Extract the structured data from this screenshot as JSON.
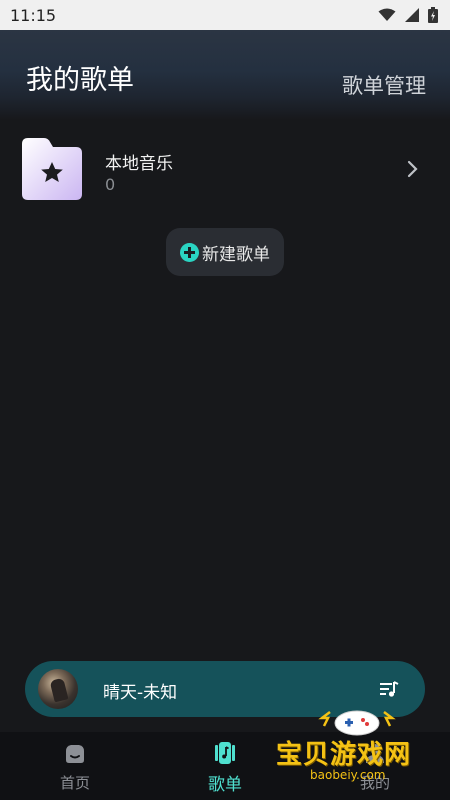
{
  "status_bar": {
    "time": "11:15"
  },
  "header": {
    "title": "我的歌单",
    "manage_label": "歌单管理"
  },
  "local_music": {
    "title": "本地音乐",
    "count": "0"
  },
  "new_playlist": {
    "label": "新建歌单"
  },
  "player": {
    "now_playing": "晴天-未知"
  },
  "bottom_nav": {
    "items": [
      {
        "label": "首页",
        "icon": "home-icon",
        "active": false
      },
      {
        "label": "歌单",
        "icon": "playlist-icon",
        "active": true
      },
      {
        "label": "我的",
        "icon": "profile-icon",
        "active": false
      }
    ]
  },
  "watermark": {
    "text": "宝贝游戏网",
    "url": "baobeiy.com"
  },
  "colors": {
    "background": "#17181b",
    "accent": "#4fe0cf",
    "player_bar": "#15525a",
    "watermark": "#f4c215"
  }
}
